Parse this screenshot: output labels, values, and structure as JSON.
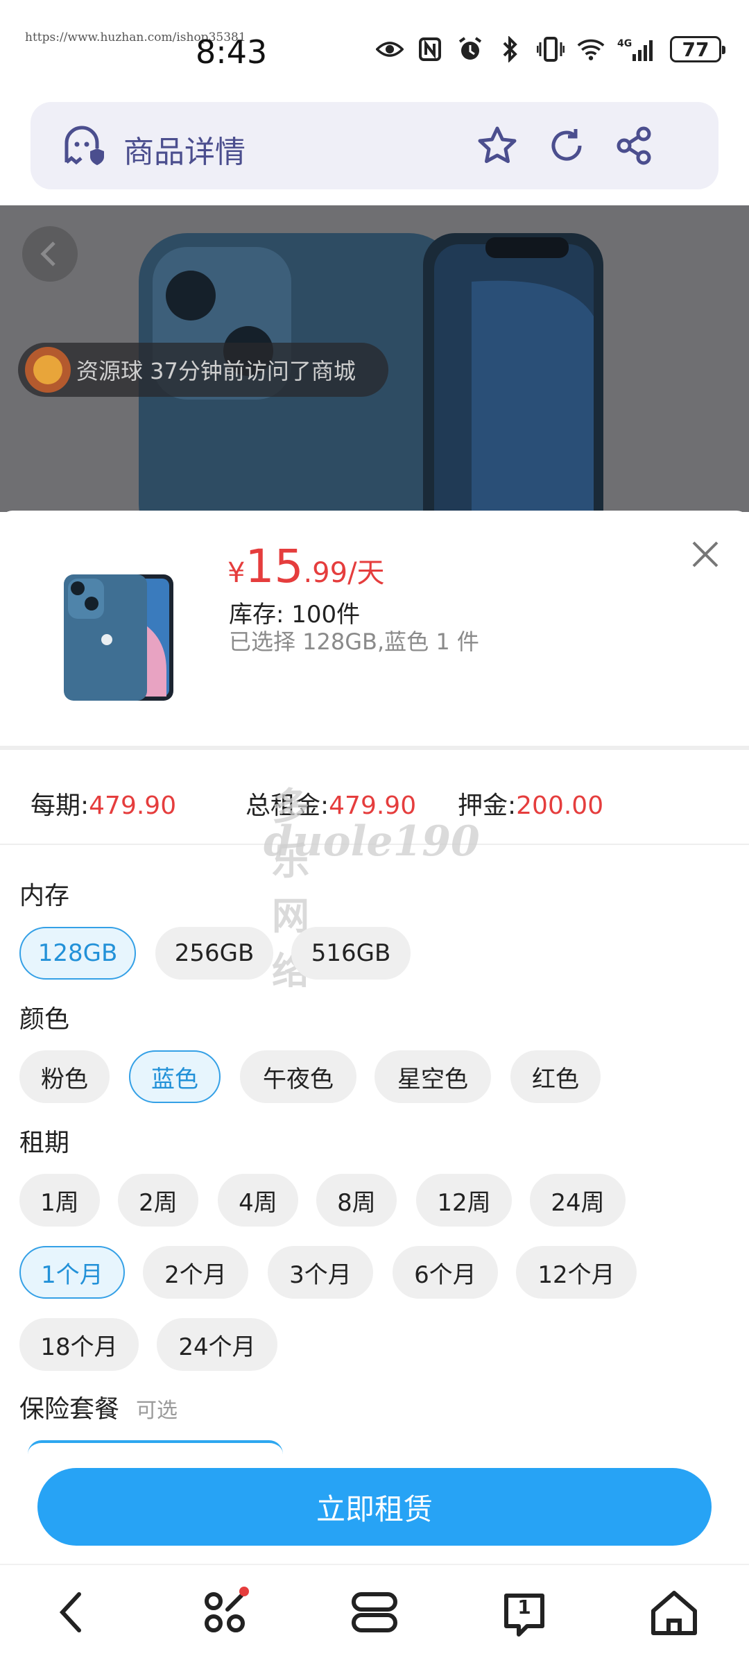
{
  "status_bar": {
    "url_overlay": "https://www.huzhan.com/ishop35381",
    "time": "8:43",
    "battery": "77",
    "network": "4G"
  },
  "browser": {
    "title": "商品详情"
  },
  "hero": {
    "visit_notice": "资源球 37分钟前访问了商城"
  },
  "sku": {
    "price_currency": "¥",
    "price_int": "15",
    "price_dec": ".99",
    "price_unit": "/天",
    "stock": "库存:  100件",
    "selected": "已选择 128GB,蓝色 1 件"
  },
  "fees": {
    "per_period_label": "每期:",
    "per_period_value": "479.90",
    "total_label": "总租金:",
    "total_value": "479.90",
    "deposit_label": "押金:",
    "deposit_value": "200.00"
  },
  "watermark": {
    "line1": "多乐网络",
    "line2": "duole190"
  },
  "options": {
    "memory": {
      "label": "内存",
      "items": [
        "128GB",
        "256GB",
        "516GB"
      ],
      "selected": "128GB"
    },
    "color": {
      "label": "颜色",
      "items": [
        "粉色",
        "蓝色",
        "午夜色",
        "星空色",
        "红色"
      ],
      "selected": "蓝色"
    },
    "term": {
      "label": "租期",
      "items": [
        "1周",
        "2周",
        "4周",
        "8周",
        "12周",
        "24周",
        "1个月",
        "2个月",
        "3个月",
        "6个月",
        "12个月",
        "18个月",
        "24个月"
      ],
      "selected": "1个月"
    },
    "insurance": {
      "label": "保险套餐",
      "sub": "可选"
    }
  },
  "cta": {
    "label": "立即租赁"
  },
  "colors": {
    "accent": "#27a3f5",
    "price": "#e53d3d",
    "browser_bar": "#efeff7",
    "browser_text": "#4b4e8e"
  },
  "bottom_nav": {
    "items": [
      "back-icon",
      "apps-icon",
      "tabs-icon",
      "tab-count-icon",
      "home-icon"
    ],
    "tab_count": "1"
  }
}
